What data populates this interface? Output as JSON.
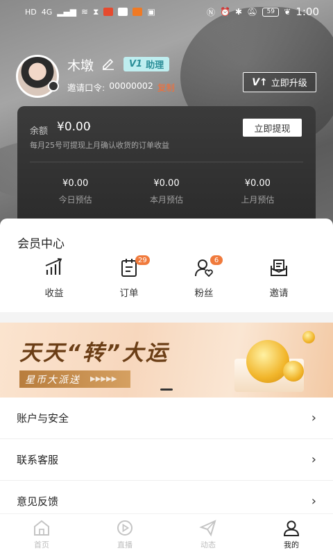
{
  "status_bar": {
    "left_indicators": [
      "HD",
      "4G"
    ],
    "battery": "59",
    "time": "1:00"
  },
  "profile": {
    "nickname": "木墩",
    "level_tag": "V1",
    "level_name": "助理",
    "invite_label": "邀请口令:",
    "invite_code": "00000002",
    "copy_label": "复制",
    "upgrade_label": "立即升级"
  },
  "balance": {
    "label": "余额",
    "amount": "¥0.00",
    "arrow": "›",
    "note": "每月25号可提现上月确认收货的订单收益",
    "withdraw_label": "立即提现",
    "stats": [
      {
        "value": "¥0.00",
        "label": "今日预估"
      },
      {
        "value": "¥0.00",
        "label": "本月预估"
      },
      {
        "value": "¥0.00",
        "label": "上月预估"
      }
    ]
  },
  "member_center": {
    "title": "会员中心",
    "items": [
      {
        "label": "收益",
        "icon": "chart-icon",
        "badge": ""
      },
      {
        "label": "订单",
        "icon": "order-icon",
        "badge": "29"
      },
      {
        "label": "粉丝",
        "icon": "fans-icon",
        "badge": "6"
      },
      {
        "label": "邀请",
        "icon": "invite-icon",
        "badge": ""
      }
    ]
  },
  "banner": {
    "title": "天天“转”大运",
    "subtitle": "星币大派送",
    "arrows": "▶▶▶▶▶"
  },
  "menu": {
    "items": [
      {
        "label": "账户与安全"
      },
      {
        "label": "联系客服"
      },
      {
        "label": "意见反馈"
      }
    ],
    "chevron": "›"
  },
  "tabbar": {
    "tabs": [
      {
        "label": "首页",
        "icon": "home-icon"
      },
      {
        "label": "直播",
        "icon": "live-icon"
      },
      {
        "label": "动态",
        "icon": "plane-icon"
      },
      {
        "label": "我的",
        "icon": "user-icon"
      }
    ]
  },
  "colors": {
    "accent_orange": "#ff6a2d",
    "badge_orange": "#f07a3c",
    "level_teal": "#2b8e98",
    "card_dark": "#333333"
  }
}
